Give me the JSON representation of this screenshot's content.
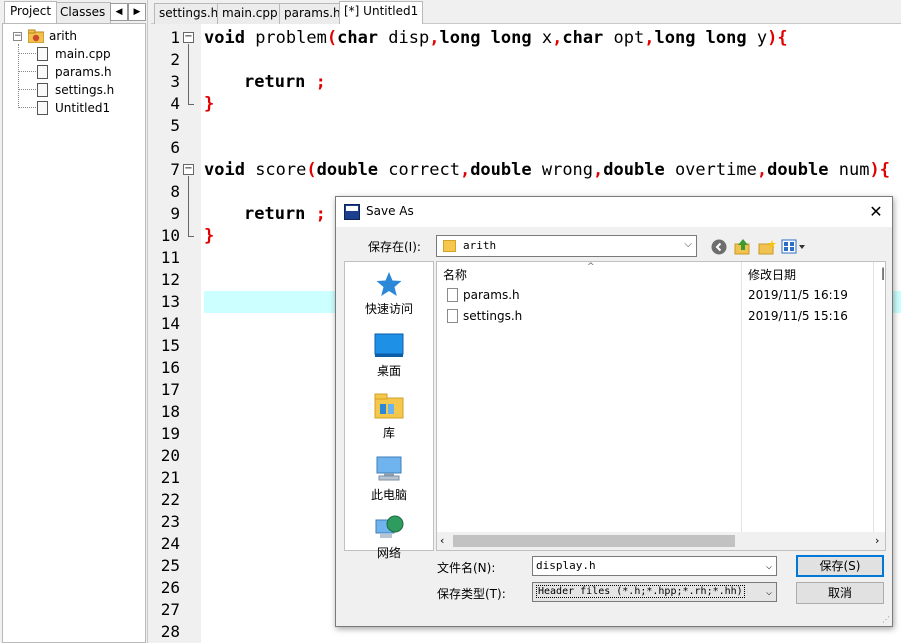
{
  "left_panel": {
    "tabs": [
      "Project",
      "Classes"
    ],
    "scroll_left": "◀",
    "scroll_right": "▶",
    "project_name": "arith",
    "files": [
      "main.cpp",
      "params.h",
      "settings.h",
      "Untitled1"
    ]
  },
  "editor": {
    "tabs": [
      "settings.h",
      "main.cpp",
      "params.h",
      "[*] Untitled1"
    ],
    "active_tab": "[*] Untitled1",
    "line_count": 28,
    "active_line": 13,
    "code": {
      "l1": {
        "kw1": "void",
        "fname": " problem",
        "p1": "(",
        "kw2": "char",
        "a1": " disp",
        "c1": ",",
        "kw3": "long long",
        "a2": " x",
        "c2": ",",
        "kw4": "char",
        "a3": " opt",
        "c3": ",",
        "kw5": "long long",
        "a4": " y",
        "p2": "){"
      },
      "l3": {
        "kw": "return",
        "sym": " ;"
      },
      "l4": {
        "sym": "}"
      },
      "l7": {
        "kw1": "void",
        "fname": " score",
        "p1": "(",
        "kw2": "double",
        "a1": " correct",
        "c1": ",",
        "kw3": "double",
        "a2": " wrong",
        "c2": ",",
        "kw4": "double",
        "a3": " overtime",
        "c3": ",",
        "kw5": "double",
        "a4": " num",
        "p2": "){"
      },
      "l9": {
        "kw": "return",
        "sym": " ;"
      },
      "l10": {
        "sym": "}"
      }
    }
  },
  "dialog": {
    "title": "Save As",
    "close": "✕",
    "save_in_label": "保存在(I):",
    "save_in_value": "arith",
    "places": [
      "快速访问",
      "桌面",
      "库",
      "此电脑",
      "网络"
    ],
    "columns": {
      "name": "名称",
      "date": "修改日期"
    },
    "files": [
      {
        "name": "params.h",
        "date": "2019/11/5 16:19"
      },
      {
        "name": "settings.h",
        "date": "2019/11/5 15:16"
      }
    ],
    "filename_label": "文件名(N):",
    "filename_value": "display.h",
    "filetype_label": "保存类型(T):",
    "filetype_value": "Header files (*.h;*.hpp;*.rh;*.hh)",
    "save_button": "保存(S)",
    "cancel_button": "取消"
  }
}
